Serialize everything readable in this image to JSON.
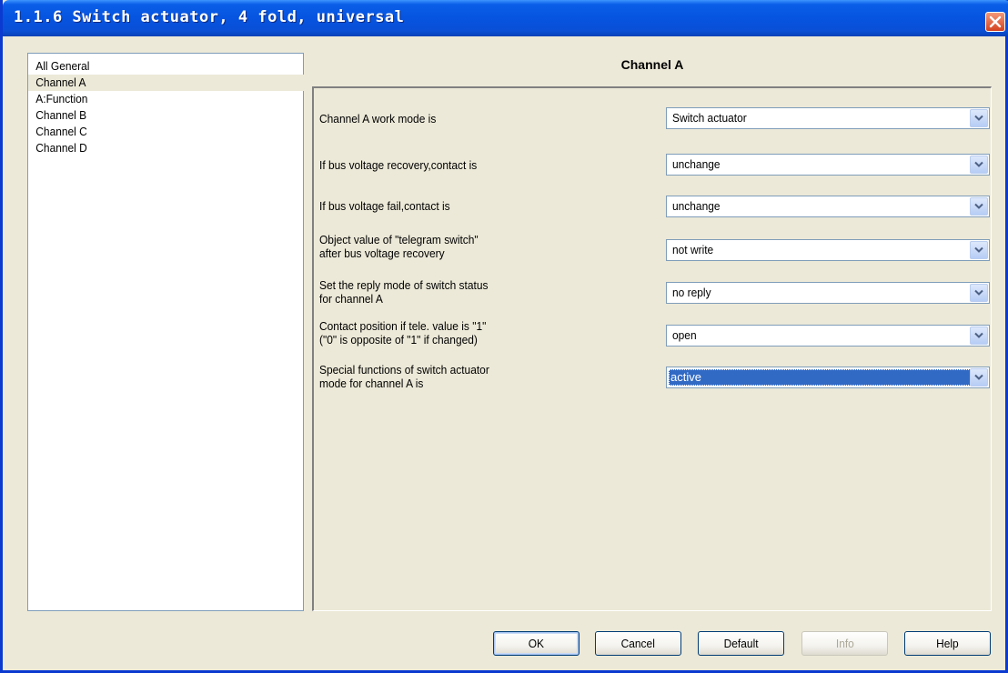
{
  "window": {
    "title": "1.1.6 Switch actuator, 4 fold, universal"
  },
  "tree": {
    "items": [
      {
        "label": "All General",
        "selected": false
      },
      {
        "label": "Channel A",
        "selected": true
      },
      {
        "label": "A:Function",
        "selected": false
      },
      {
        "label": "Channel B",
        "selected": false
      },
      {
        "label": "Channel C",
        "selected": false
      },
      {
        "label": "Channel D",
        "selected": false
      }
    ]
  },
  "panel": {
    "title": "Channel A"
  },
  "params": [
    {
      "line1": "Channel A work mode is",
      "line2": "",
      "value": "Switch actuator"
    },
    {
      "line1": "If bus voltage recovery,contact is",
      "line2": "",
      "value": "unchange"
    },
    {
      "line1": "If bus voltage fail,contact is",
      "line2": "",
      "value": "unchange"
    },
    {
      "line1": "Object value of \"telegram switch\"",
      "line2": "after bus voltage recovery",
      "value": "not write"
    },
    {
      "line1": "Set the reply mode of switch status",
      "line2": "for channel A",
      "value": "no reply"
    },
    {
      "line1": "Contact position if tele. value is \"1\"",
      "line2": " (\"0\" is opposite of \"1\" if changed)",
      "value": "open"
    },
    {
      "line1": "Special functions of switch actuator",
      "line2": " mode for channel A is",
      "value": "active"
    }
  ],
  "buttons": {
    "ok": "OK",
    "cancel": "Cancel",
    "default": "Default",
    "info": "Info",
    "help": "Help"
  },
  "colors": {
    "titlebar": "#0654e0",
    "selection": "#316ac5",
    "window_bg": "#ece9d8"
  }
}
